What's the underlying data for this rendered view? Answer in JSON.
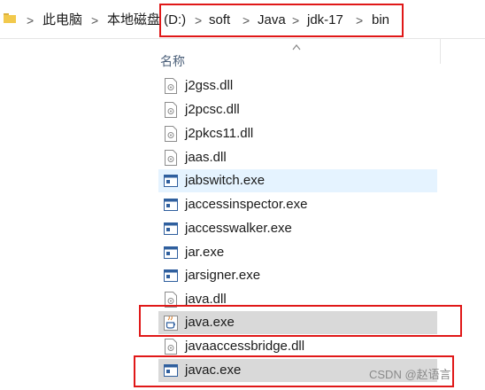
{
  "breadcrumb": {
    "items": [
      {
        "name": "breadcrumb-this-pc",
        "label": "此电脑"
      },
      {
        "name": "breadcrumb-local-disk",
        "label": "本地磁盘 (D:)"
      },
      {
        "name": "breadcrumb-soft",
        "label": "soft"
      },
      {
        "name": "breadcrumb-java",
        "label": "Java"
      },
      {
        "name": "breadcrumb-jdk17",
        "label": "jdk-17"
      },
      {
        "name": "breadcrumb-bin",
        "label": "bin"
      }
    ],
    "separator": ">"
  },
  "file_list": {
    "column_header": "名称",
    "files": [
      {
        "name": "j2gss.dll",
        "type": "dll"
      },
      {
        "name": "j2pcsc.dll",
        "type": "dll"
      },
      {
        "name": "j2pkcs11.dll",
        "type": "dll"
      },
      {
        "name": "jaas.dll",
        "type": "dll"
      },
      {
        "name": "jabswitch.exe",
        "type": "exe",
        "state": "hover"
      },
      {
        "name": "jaccessinspector.exe",
        "type": "exe"
      },
      {
        "name": "jaccesswalker.exe",
        "type": "exe"
      },
      {
        "name": "jar.exe",
        "type": "exe"
      },
      {
        "name": "jarsigner.exe",
        "type": "exe"
      },
      {
        "name": "java.dll",
        "type": "dll"
      },
      {
        "name": "java.exe",
        "type": "java-exe",
        "state": "selected"
      },
      {
        "name": "javaaccessbridge.dll",
        "type": "dll"
      },
      {
        "name": "javac.exe",
        "type": "exe",
        "state": "selected"
      }
    ]
  },
  "watermark": "CSDN @赵语言",
  "colors": {
    "highlight": "#e01818",
    "hover_bg": "#e5f3ff",
    "selected_bg": "#d9d9d9",
    "header_text": "#4c607a"
  }
}
